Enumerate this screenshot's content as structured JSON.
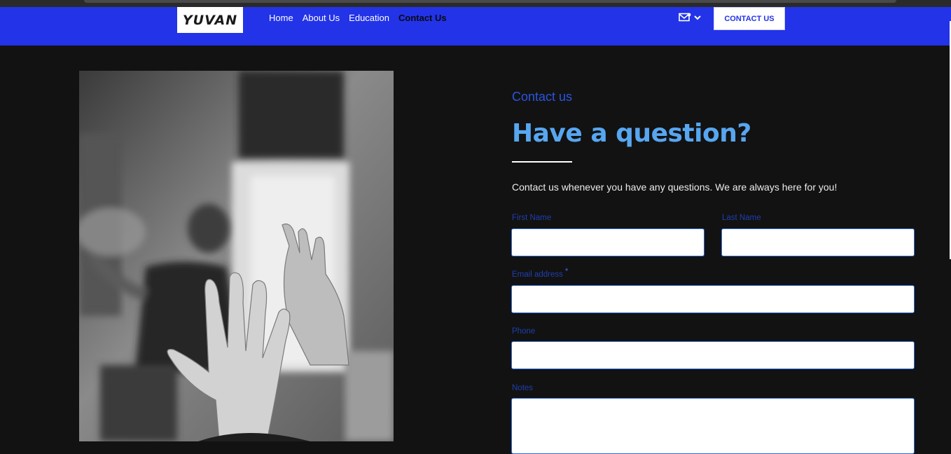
{
  "header": {
    "logo_text": "YUVAN",
    "nav": [
      "Home",
      "About Us",
      "Education",
      "Contact Us"
    ],
    "active_nav": "Contact Us",
    "cta_label": "CONTACT US",
    "mail_icon": "mail-icon",
    "chevron_icon": "chevron-down-icon",
    "brand_color": "#2233e8"
  },
  "main": {
    "eyebrow": "Contact us",
    "heading": "Have a question?",
    "intro": "Contact us whenever you have any questions. We are always here for you!",
    "accent_color": "#57a6f0",
    "form": {
      "first_name_label": "First Name",
      "last_name_label": "Last Name",
      "email_label": "Email address",
      "email_required_mark": "*",
      "phone_label": "Phone",
      "notes_label": "Notes",
      "first_name_value": "",
      "last_name_value": "",
      "email_value": "",
      "phone_value": "",
      "notes_value": ""
    }
  }
}
